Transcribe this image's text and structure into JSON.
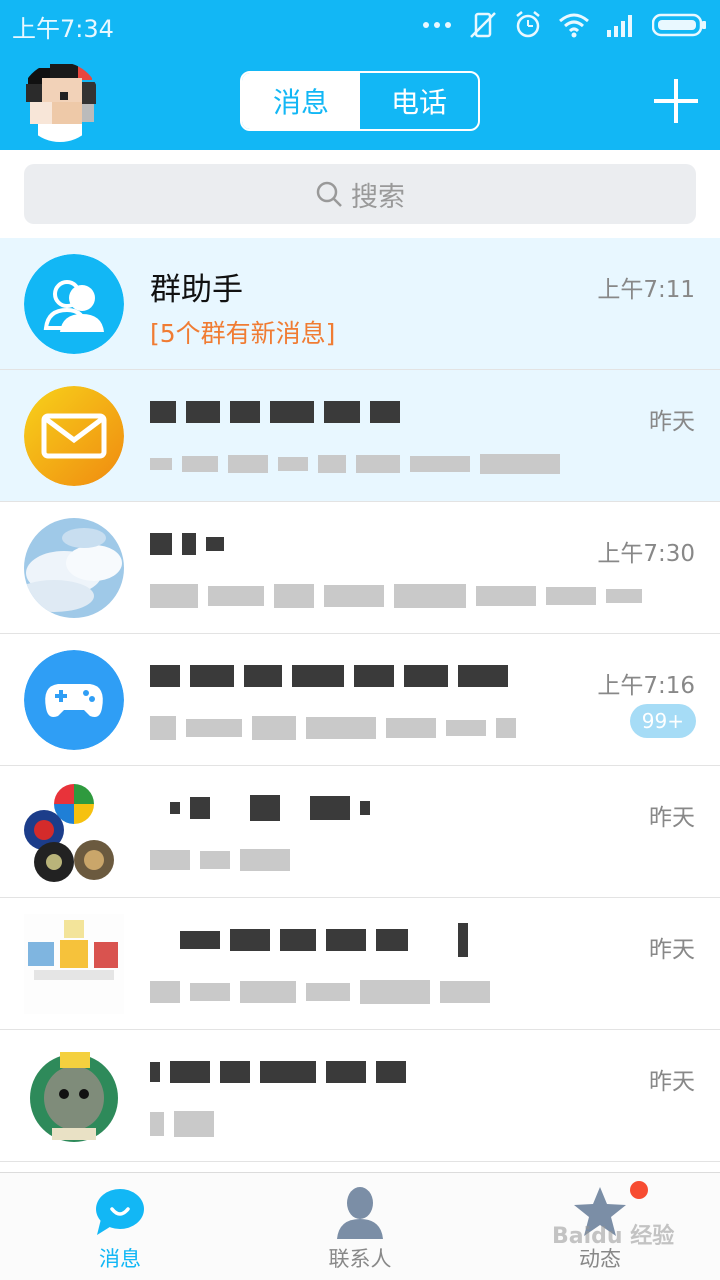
{
  "status_bar": {
    "time": "上午7:34",
    "icons": [
      "more-dots-icon",
      "vibrate-off-icon",
      "alarm-icon",
      "wifi-icon",
      "signal-icon",
      "battery-icon"
    ]
  },
  "header": {
    "tabs": [
      {
        "label": "消息",
        "active": true
      },
      {
        "label": "电话",
        "active": false
      }
    ],
    "add_icon": "plus-icon"
  },
  "search": {
    "placeholder": "搜索"
  },
  "conversations": [
    {
      "title": "群助手",
      "subtitle": "[5个群有新消息]",
      "time": "上午7:11",
      "highlighted": true
    },
    {
      "title": "",
      "subtitle": "",
      "time": "昨天",
      "highlighted": true
    },
    {
      "title": "",
      "subtitle": "",
      "time": "上午7:30",
      "highlighted": false
    },
    {
      "title": "",
      "subtitle": "",
      "time": "上午7:16",
      "badge": "99+",
      "highlighted": false
    },
    {
      "title": "",
      "subtitle": "",
      "time": "昨天",
      "highlighted": false
    },
    {
      "title": "",
      "subtitle": "",
      "time": "昨天",
      "highlighted": false
    },
    {
      "title": "",
      "subtitle": "",
      "time": "昨天",
      "highlighted": false
    }
  ],
  "bottom_nav": [
    {
      "label": "消息",
      "icon": "chat-bubble-icon",
      "active": true
    },
    {
      "label": "联系人",
      "icon": "contact-person-icon",
      "active": false
    },
    {
      "label": "动态",
      "icon": "star-icon",
      "active": false,
      "has_dot": true
    }
  ],
  "watermark": "Baidu 经验",
  "colors": {
    "primary": "#12b7f5",
    "highlight_row": "#e8f7ff",
    "orange": "#f07c33"
  }
}
